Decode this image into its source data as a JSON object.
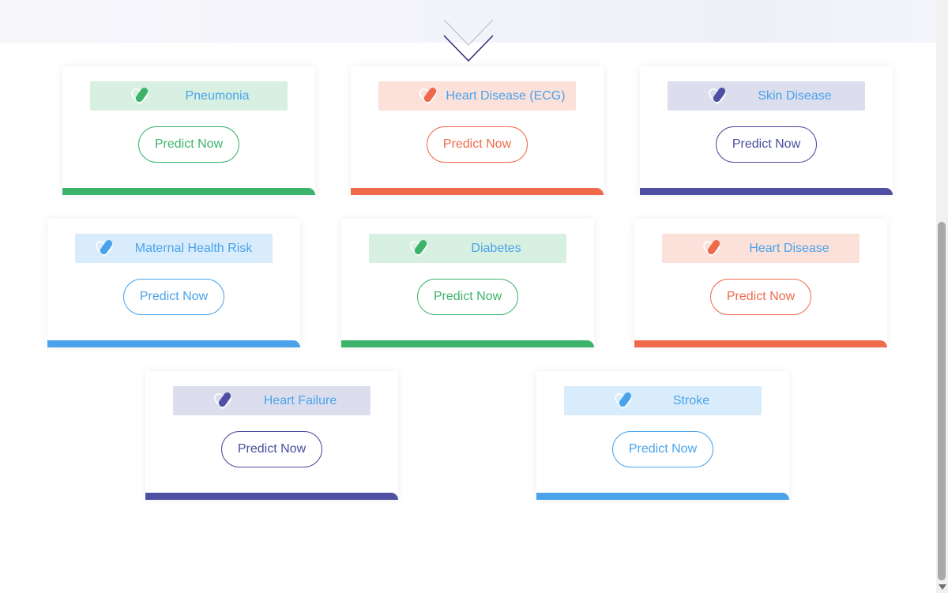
{
  "colors": {
    "green": "#3cb36a",
    "orange": "#ef6a4b",
    "indigo": "#4f50a3",
    "blue": "#4aa3ea"
  },
  "icons": {
    "scroll_down": "chevron-down-icon",
    "card_icon": "pill-heart-icon"
  },
  "cards": [
    {
      "title": "Pneumonia",
      "button": "Predict Now",
      "theme": "green"
    },
    {
      "title": "Heart Disease (ECG)",
      "button": "Predict Now",
      "theme": "orange"
    },
    {
      "title": "Skin Disease",
      "button": "Predict Now",
      "theme": "indigo"
    },
    {
      "title": "Maternal Health Risk",
      "button": "Predict Now",
      "theme": "blue"
    },
    {
      "title": "Diabetes",
      "button": "Predict Now",
      "theme": "green"
    },
    {
      "title": "Heart Disease",
      "button": "Predict Now",
      "theme": "orange"
    },
    {
      "title": "Heart Failure",
      "button": "Predict Now",
      "theme": "indigo"
    },
    {
      "title": "Stroke",
      "button": "Predict Now",
      "theme": "blue"
    }
  ]
}
